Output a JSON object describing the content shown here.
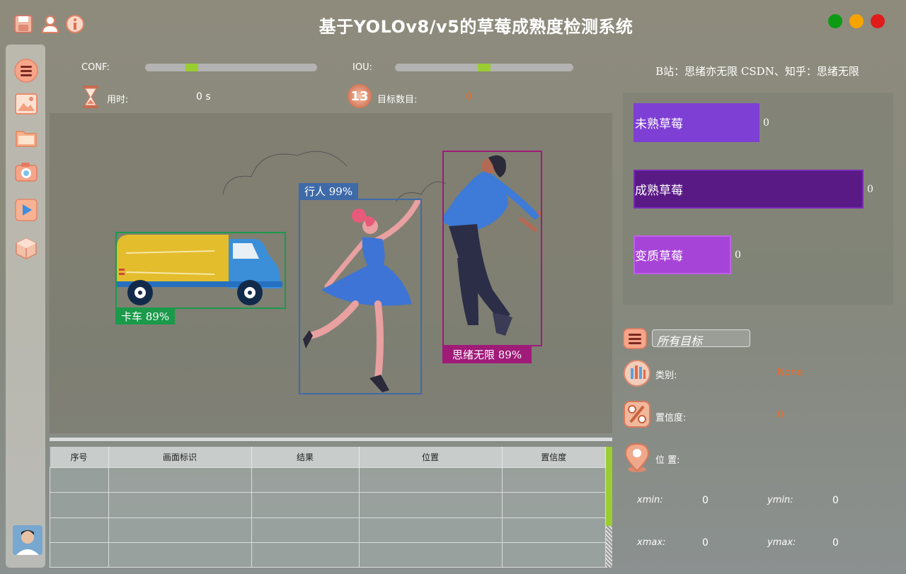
{
  "window": {
    "title": "基于YOLOv8/v5的草莓成熟度检测系统",
    "colors": {
      "close": "#e01b1b",
      "minimize": "#f5a300",
      "maximize": "#0e9b14"
    }
  },
  "titlebar_icons": [
    "save-icon",
    "user-icon",
    "info-icon"
  ],
  "sidebar": {
    "items": [
      "menu-icon",
      "image-icon",
      "folder-icon",
      "camera-icon",
      "video-play-icon",
      "model-cube-icon"
    ],
    "avatar": "avatar"
  },
  "controls": {
    "conf_label": "CONF:",
    "conf_value": 0.28,
    "iou_label": "IOU:",
    "iou_value": 0.5,
    "time_label": "用时:",
    "time_value": "0 s",
    "count_label": "目标数目:",
    "count_value": "0",
    "count_icon_text": "13"
  },
  "detections": [
    {
      "label": "卡车  89%",
      "color": "#1a9a4a"
    },
    {
      "label": "行人  99%",
      "color": "#3e6aa8"
    },
    {
      "label": "思绪无限  89%",
      "color": "#a01a78"
    }
  ],
  "table": {
    "columns": [
      "序号",
      "画面标识",
      "结果",
      "位置",
      "置信度"
    ],
    "rows": [
      [
        "",
        "",
        "",
        "",
        ""
      ],
      [
        "",
        "",
        "",
        "",
        ""
      ],
      [
        "",
        "",
        "",
        "",
        ""
      ],
      [
        "",
        "",
        "",
        "",
        ""
      ]
    ]
  },
  "credits": "B站：思绪亦无限  CSDN、知乎：思绪无限",
  "chart_data": {
    "type": "bar",
    "orientation": "horizontal",
    "categories": [
      "未熟草莓",
      "成熟草莓",
      "变质草莓"
    ],
    "values": [
      0,
      0,
      0
    ],
    "colors": [
      "#7e3fd4",
      "#5a1a86",
      "#a744d8"
    ]
  },
  "filter": {
    "placeholder": "所有目标"
  },
  "details": {
    "class_label": "类别:",
    "class_value": "None",
    "conf_label": "置信度:",
    "conf_value": "0",
    "pos_label": "位 置:",
    "xmin_label": "xmin:",
    "xmin_value": "0",
    "ymin_label": "ymin:",
    "ymin_value": "0",
    "xmax_label": "xmax:",
    "xmax_value": "0",
    "ymax_label": "ymax:",
    "ymax_value": "0"
  }
}
